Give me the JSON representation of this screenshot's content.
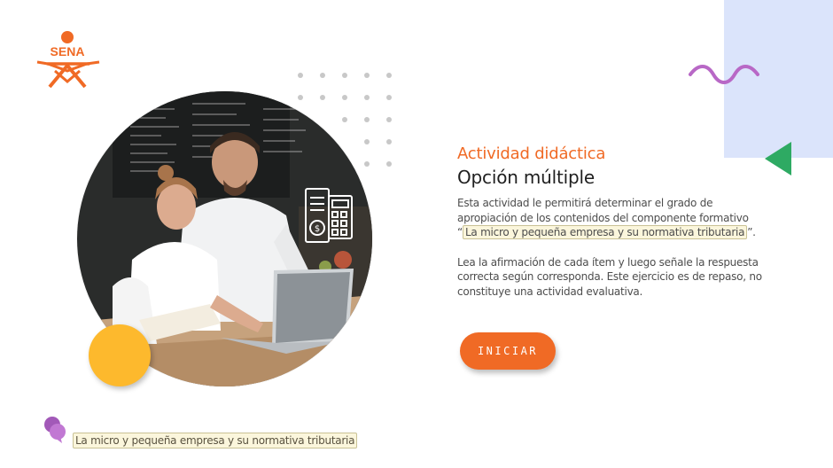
{
  "brand": {
    "logo_text": "SENA",
    "logo_color": "#f06a25"
  },
  "colors": {
    "accent": "#f06a25",
    "panel_blue": "#dbe4fb",
    "squiggle_purple": "#b868c6",
    "triangle_green": "#2eaa63",
    "circle_yellow": "#fdb92d"
  },
  "main": {
    "kicker": "Actividad didáctica",
    "heading": "Opción múltiple",
    "para1_before": "Esta actividad le permitirá determinar el grado de apropiación de los contenidos del componente formativo “",
    "para1_highlight": "La micro y pequeña empresa y su normativa tributaria",
    "para1_after": "”.",
    "para2": "Lea la afirmación de cada ítem y luego señale la respuesta correcta según corresponda.  Este ejercicio es de repaso, no constituye una actividad evaluativa."
  },
  "start_button": {
    "label": "INICIAR"
  },
  "footer": {
    "icon": "purple-bubble-icon",
    "label": "La micro y pequeña empresa y su normativa tributaria"
  },
  "illustration": {
    "description_icon": "invoice-calculator-icon"
  }
}
